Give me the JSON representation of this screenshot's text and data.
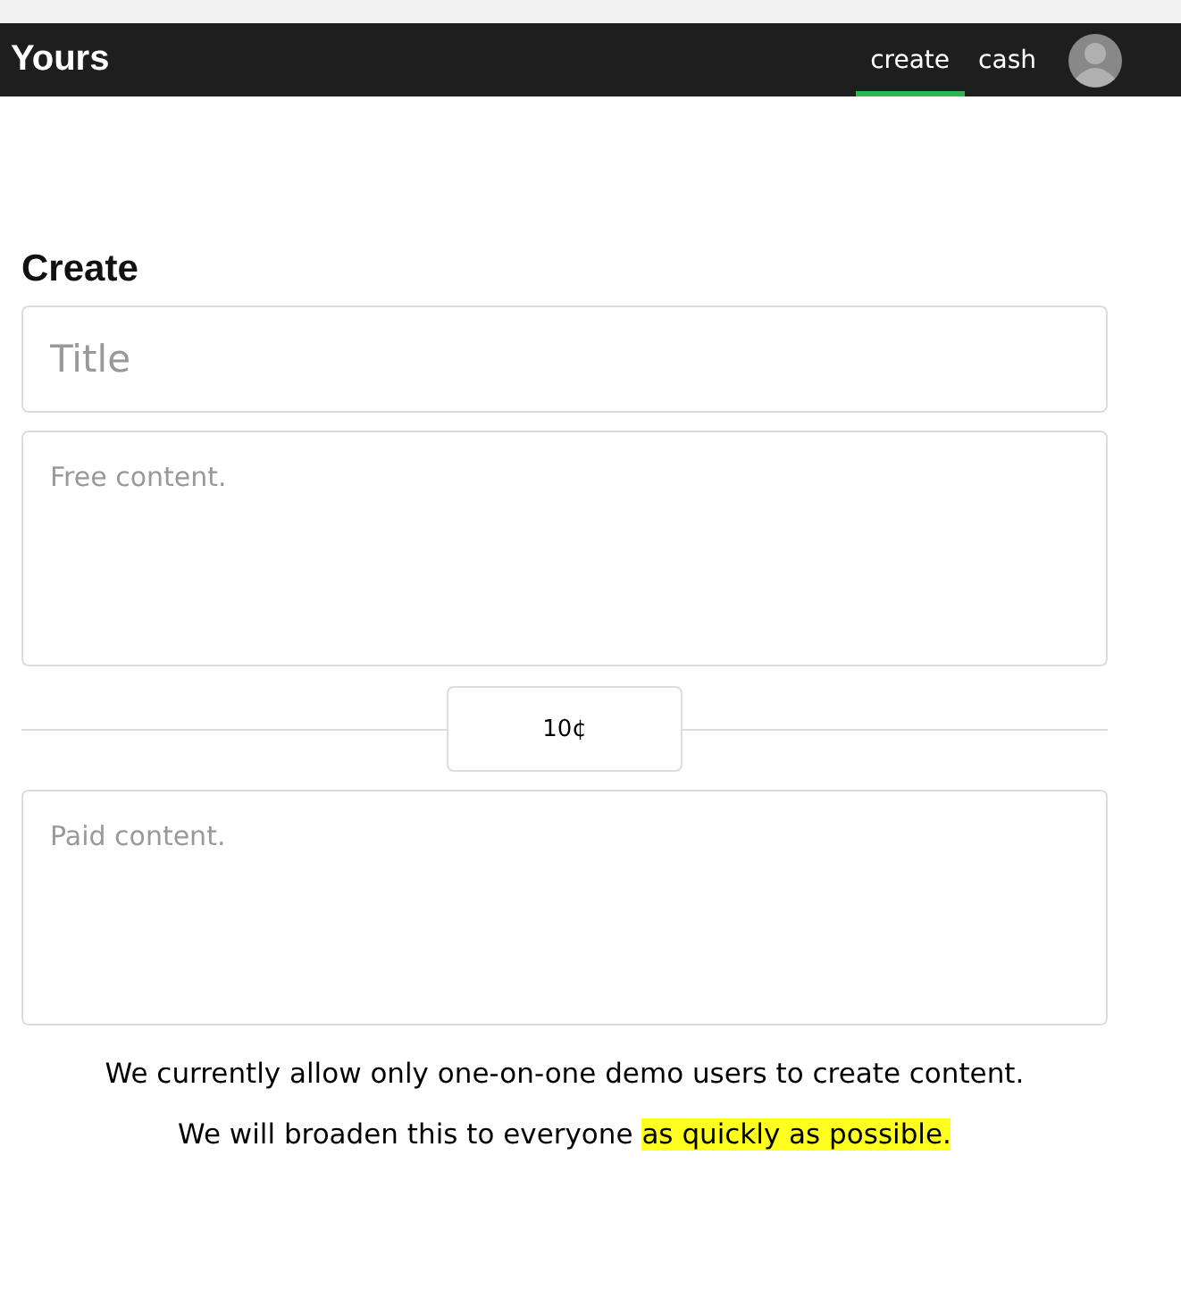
{
  "navbar": {
    "brand": "Yours",
    "tabs": [
      {
        "label": "create",
        "selected": true
      },
      {
        "label": "cash",
        "selected": false
      }
    ]
  },
  "form": {
    "heading": "Create",
    "title_field": {
      "placeholder": "Title"
    },
    "free_field": {
      "placeholder": "Free content."
    },
    "price_field": {
      "value": "10¢"
    },
    "paid_field": {
      "placeholder": "Paid content."
    }
  },
  "notes": [
    {
      "text": "We currently allow only one-on-one demo users to create content."
    },
    {
      "text": "We will broaden this to everyone ",
      "highlight": "as quickly as possible."
    }
  ]
}
